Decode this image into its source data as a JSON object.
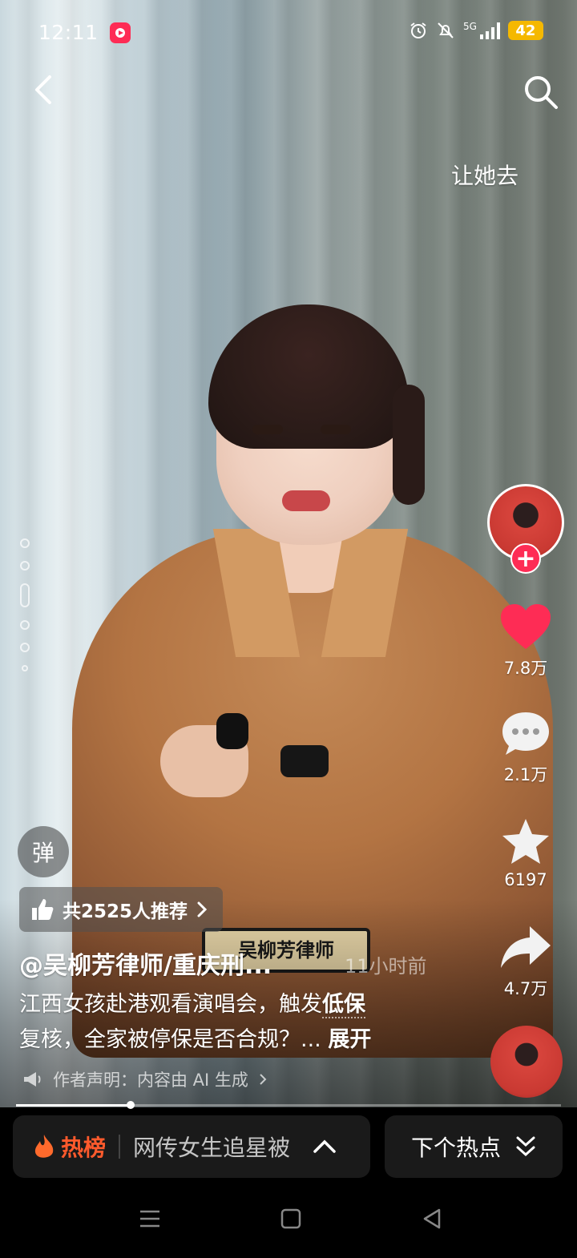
{
  "status_bar": {
    "time": "12:11",
    "network": "5G",
    "battery": "42",
    "icons": [
      "alarm-icon",
      "mute-icon",
      "signal-icon",
      "battery-icon"
    ]
  },
  "header": {
    "overlay_text": "让她去"
  },
  "actions": {
    "likes": "7.8万",
    "comments": "2.1万",
    "favorites": "6197",
    "shares": "4.7万"
  },
  "danmaku": {
    "label": "弹"
  },
  "recommend": {
    "label": "共2525人推荐"
  },
  "video_info": {
    "author": "@吴柳芳律师/重庆刑...",
    "time_ago": "11小时前",
    "caption_line1_prefix": "江西女孩赴港观看演唱会，触发",
    "caption_line1_bold": "低保",
    "caption_line2": "复核，全家被停保是否合规？...",
    "expand_label": "展开",
    "ai_declaration": "作者声明：内容由 AI 生成"
  },
  "video_overlay": {
    "nameplate_text": "吴柳芳律师"
  },
  "playback": {
    "progress": 0.21
  },
  "hot_bar": {
    "title": "热榜",
    "topic": "网传女生追星被",
    "next_label": "下个热点"
  },
  "colors": {
    "accent": "#fe2c55",
    "hot": "#ff5a2c",
    "battery": "#f5b800"
  }
}
